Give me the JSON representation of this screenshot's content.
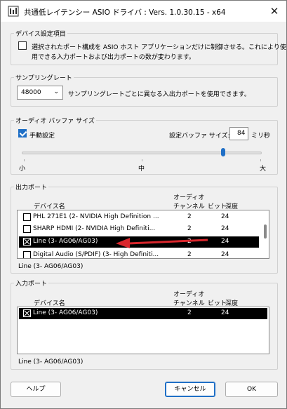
{
  "window": {
    "title": "共通低レイテンシー ASIO ドライバ : Vers. 1.0.30.15 - x64",
    "close_glyph": "✕"
  },
  "device_settings": {
    "group_label": "デバイス設定項目",
    "checkbox_checked": false,
    "text_line1": "選択されたポート構成を ASIO ホスト アプリケーションだけに制御させる。これにより使",
    "text_line2": "用できる入力ポートおよび出力ポートの数が変わります。"
  },
  "sampling_rate": {
    "group_label": "サンプリングレート",
    "value": "48000",
    "description": "サンプリングレートごとに異なる入出力ポートを使用できます。"
  },
  "audio_buffer": {
    "group_label": "オーディオ バッファ サイズ",
    "manual_label": "手動設定",
    "manual_checked": true,
    "buffer_label": "設定バッファ サイズ:",
    "buffer_value": "84",
    "buffer_unit": "ミリ秒",
    "slider_level": 0.84,
    "scale_small": "小",
    "scale_medium": "中",
    "scale_large": "大"
  },
  "output_ports": {
    "group_label": "出力ポート",
    "header_device": "デバイス名",
    "header_audio": "オーディオ",
    "header_channel": "チャンネル",
    "header_bit": "ビット",
    "header_depth": "深度",
    "rows": [
      {
        "name": "PHL 271E1 (2- NVIDIA High Definition ...",
        "channels": "2",
        "depth": "24",
        "checked": false,
        "selected": false
      },
      {
        "name": "SHARP HDMI (2- NVIDIA High Definiti...",
        "channels": "2",
        "depth": "24",
        "checked": false,
        "selected": false
      },
      {
        "name": "Line (3- AG06/AG03)",
        "channels": "2",
        "depth": "24",
        "checked": true,
        "selected": true
      },
      {
        "name": "Digital Audio (S/PDIF) (3- High Definiti...",
        "channels": "2",
        "depth": "24",
        "checked": false,
        "selected": false
      }
    ],
    "selected_status": "Line (3- AG06/AG03)"
  },
  "input_ports": {
    "group_label": "入力ポート",
    "header_device": "デバイス名",
    "header_audio": "オーディオ",
    "header_channel": "チャンネル",
    "header_bit": "ビット",
    "header_depth": "深度",
    "rows": [
      {
        "name": "Line (3- AG06/AG03)",
        "channels": "2",
        "depth": "24",
        "checked": true,
        "selected": true
      }
    ],
    "selected_status": "Line (3- AG06/AG03)"
  },
  "buttons": {
    "help": "ヘルプ",
    "cancel": "キャンセル",
    "ok": "OK"
  },
  "colors": {
    "accent": "#1f6fc6",
    "annotation_arrow": "#d9262c",
    "selection": "#000000"
  }
}
